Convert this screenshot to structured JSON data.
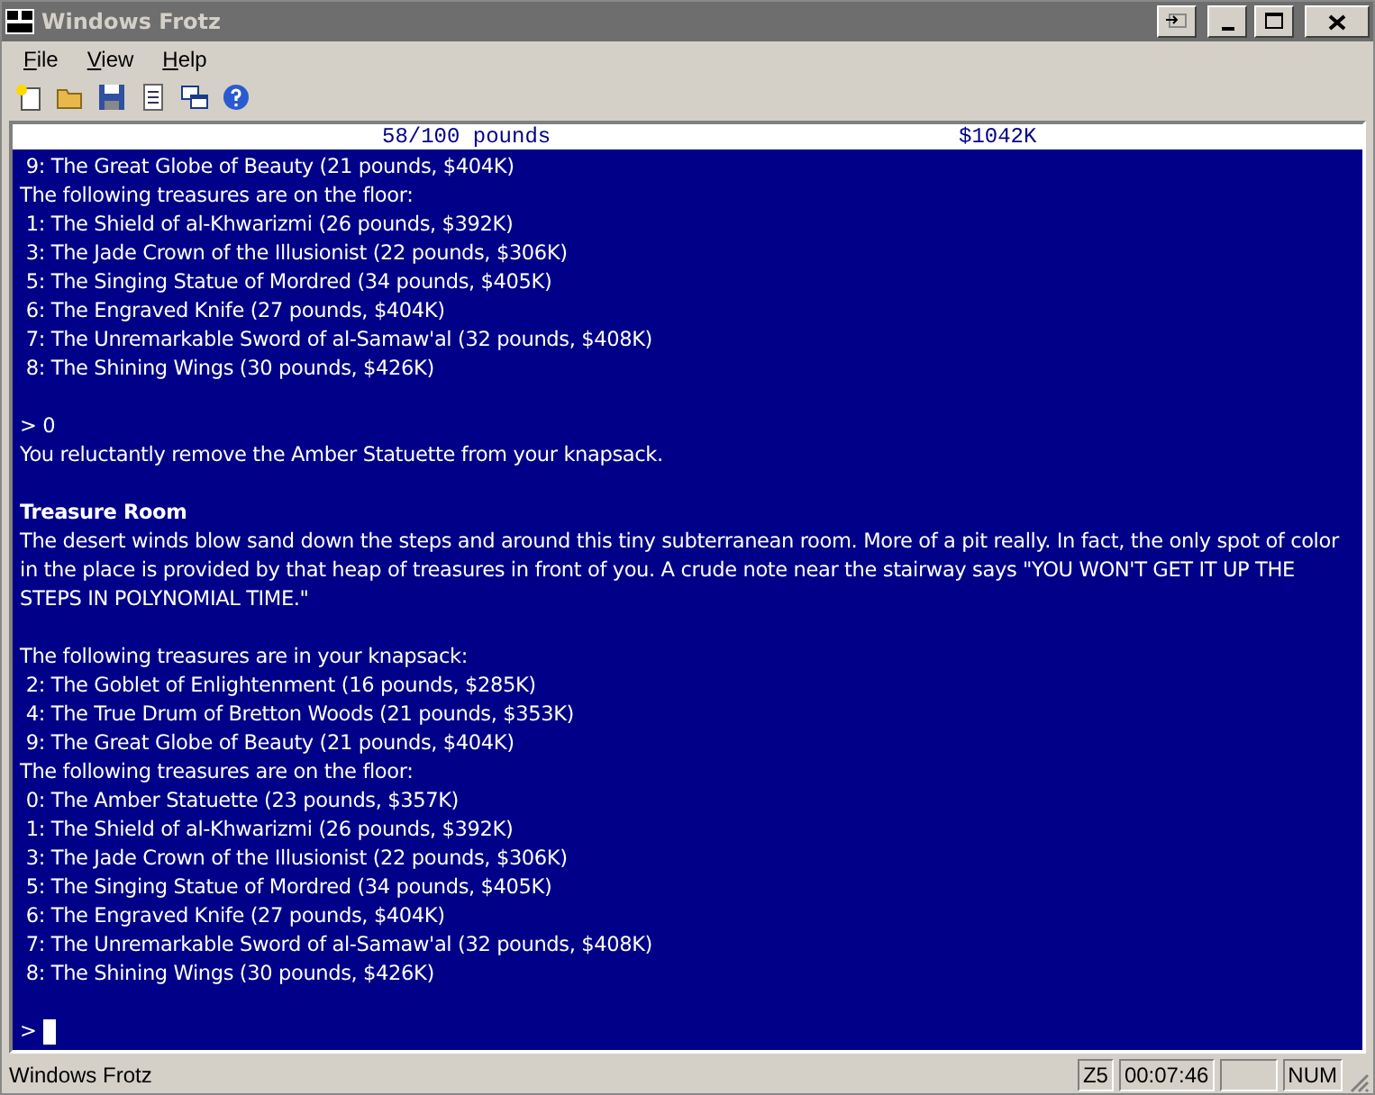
{
  "window": {
    "title": "Windows Frotz",
    "active": false
  },
  "menu": [
    "File",
    "View",
    "Help"
  ],
  "status_line": {
    "left": "58/100 pounds",
    "right": "$1042K"
  },
  "transcript": [
    {
      "kind": "line",
      "text": " 9: The Great Globe of Beauty (21 pounds, $404K)"
    },
    {
      "kind": "line",
      "text": "The following treasures are on the floor:"
    },
    {
      "kind": "line",
      "text": " 1: The Shield of al-Khwarizmi (26 pounds, $392K)"
    },
    {
      "kind": "line",
      "text": " 3: The Jade Crown of the Illusionist (22 pounds, $306K)"
    },
    {
      "kind": "line",
      "text": " 5: The Singing Statue of Mordred (34 pounds, $405K)"
    },
    {
      "kind": "line",
      "text": " 6: The Engraved Knife (27 pounds, $404K)"
    },
    {
      "kind": "line",
      "text": " 7: The Unremarkable Sword of al-Samaw'al (32 pounds, $408K)"
    },
    {
      "kind": "line",
      "text": " 8: The Shining Wings (30 pounds, $426K)"
    },
    {
      "kind": "blank"
    },
    {
      "kind": "line",
      "text": "> 0"
    },
    {
      "kind": "line",
      "text": "You reluctantly remove the Amber Statuette from your knapsack."
    },
    {
      "kind": "blank"
    },
    {
      "kind": "heading",
      "text": "Treasure Room"
    },
    {
      "kind": "paragraph",
      "text": "The desert winds blow sand down the steps and around this tiny subterranean room. More of a pit really. In fact, the only spot of color in the place is provided by that heap of treasures in front of you. A crude note near the stairway says \"YOU WON'T GET IT UP THE STEPS IN POLYNOMIAL TIME.\""
    },
    {
      "kind": "blank"
    },
    {
      "kind": "line",
      "text": "The following treasures are in your knapsack:"
    },
    {
      "kind": "line",
      "text": " 2: The Goblet of Enlightenment (16 pounds, $285K)"
    },
    {
      "kind": "line",
      "text": " 4: The True Drum of Bretton Woods (21 pounds, $353K)"
    },
    {
      "kind": "line",
      "text": " 9: The Great Globe of Beauty (21 pounds, $404K)"
    },
    {
      "kind": "line",
      "text": "The following treasures are on the floor:"
    },
    {
      "kind": "line",
      "text": " 0: The Amber Statuette (23 pounds, $357K)"
    },
    {
      "kind": "line",
      "text": " 1: The Shield of al-Khwarizmi (26 pounds, $392K)"
    },
    {
      "kind": "line",
      "text": " 3: The Jade Crown of the Illusionist (22 pounds, $306K)"
    },
    {
      "kind": "line",
      "text": " 5: The Singing Statue of Mordred (34 pounds, $405K)"
    },
    {
      "kind": "line",
      "text": " 6: The Engraved Knife (27 pounds, $404K)"
    },
    {
      "kind": "line",
      "text": " 7: The Unremarkable Sword of al-Samaw'al (32 pounds, $408K)"
    },
    {
      "kind": "line",
      "text": " 8: The Shining Wings (30 pounds, $426K)"
    },
    {
      "kind": "blank"
    }
  ],
  "input": {
    "prompt": ">",
    "cursor": true
  },
  "status_bar": {
    "text": "Windows Frotz",
    "panels": [
      "Z5",
      "00:07:46",
      "NUM"
    ]
  }
}
